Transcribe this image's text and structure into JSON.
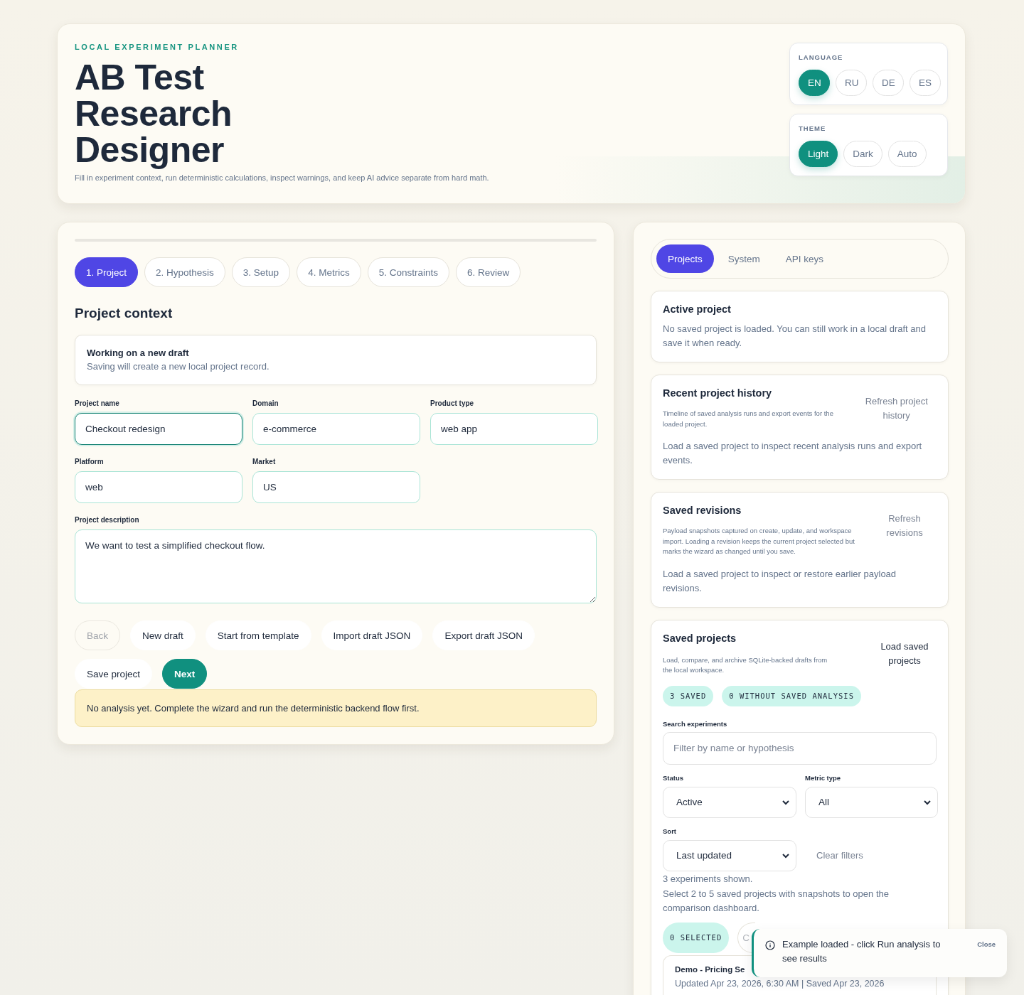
{
  "header": {
    "eyebrow": "LOCAL EXPERIMENT PLANNER",
    "title": "AB Test Research Designer",
    "subtitle": "Fill in experiment context, run deterministic calculations, inspect warnings, and keep AI advice separate from hard math."
  },
  "language": {
    "label": "LANGUAGE",
    "options": [
      {
        "label": "EN",
        "selected": true
      },
      {
        "label": "RU",
        "selected": false
      },
      {
        "label": "DE",
        "selected": false
      },
      {
        "label": "ES",
        "selected": false
      }
    ]
  },
  "theme": {
    "label": "THEME",
    "options": [
      {
        "label": "Light",
        "selected": true
      },
      {
        "label": "Dark",
        "selected": false
      },
      {
        "label": "Auto",
        "selected": false
      }
    ]
  },
  "wizard": {
    "steps": [
      {
        "label": "1. Project",
        "selected": true
      },
      {
        "label": "2. Hypothesis",
        "selected": false
      },
      {
        "label": "3. Setup",
        "selected": false
      },
      {
        "label": "4. Metrics",
        "selected": false
      },
      {
        "label": "5. Constraints",
        "selected": false
      },
      {
        "label": "6. Review",
        "selected": false
      }
    ],
    "section_title": "Project context",
    "draft_notice": {
      "title": "Working on a new draft",
      "text": "Saving will create a new local project record."
    },
    "fields": [
      {
        "label": "Project name",
        "value": "Checkout redesign",
        "focused": true
      },
      {
        "label": "Domain",
        "value": "e-commerce",
        "focused": false
      },
      {
        "label": "Product type",
        "value": "web app",
        "focused": false
      },
      {
        "label": "Platform",
        "value": "web",
        "focused": false
      },
      {
        "label": "Market",
        "value": "US",
        "focused": false
      }
    ],
    "description": {
      "label": "Project description",
      "value": "We want to test a simplified checkout flow."
    },
    "actions": [
      {
        "label": "Back",
        "primary": false,
        "disabled": true
      },
      {
        "label": "New draft",
        "primary": false,
        "disabled": false
      },
      {
        "label": "Start from template",
        "primary": false,
        "disabled": false
      },
      {
        "label": "Import draft JSON",
        "primary": false,
        "disabled": false
      },
      {
        "label": "Export draft JSON",
        "primary": false,
        "disabled": false
      },
      {
        "label": "Save project",
        "primary": false,
        "disabled": false
      },
      {
        "label": "Next",
        "primary": true,
        "disabled": false
      }
    ],
    "notice": "No analysis yet. Complete the wizard and run the deterministic backend flow first."
  },
  "sidebar": {
    "tabs": [
      {
        "label": "Projects",
        "selected": true
      },
      {
        "label": "System",
        "selected": false
      },
      {
        "label": "API keys",
        "selected": false
      }
    ],
    "active_project": {
      "title": "Active project",
      "text": "No saved project is loaded. You can still work in a local draft and save it when ready."
    },
    "history": {
      "title": "Recent project history",
      "description": "Timeline of saved analysis runs and export events for the loaded project.",
      "action": "Refresh project history",
      "empty": "Load a saved project to inspect recent analysis runs and export events."
    },
    "revisions": {
      "title": "Saved revisions",
      "description": "Payload snapshots captured on create, update, and workspace import. Loading a revision keeps the current project selected but marks the wizard as changed until you save.",
      "action": "Refresh revisions",
      "empty": "Load a saved project to inspect or restore earlier payload revisions."
    },
    "saved_projects": {
      "title": "Saved projects",
      "description": "Load, compare, and archive SQLite-backed drafts from the local workspace.",
      "action": "Load saved projects",
      "badges": [
        "3 SAVED",
        "0 WITHOUT SAVED ANALYSIS"
      ],
      "search": {
        "label": "Search experiments",
        "placeholder": "Filter by name or hypothesis"
      },
      "filters": [
        {
          "label": "Status",
          "value": "Active"
        },
        {
          "label": "Metric type",
          "value": "All"
        }
      ],
      "sort": {
        "label": "Sort",
        "value": "Last updated"
      },
      "clear": "Clear filters",
      "count": "3 experiments shown.",
      "hint": "Select 2 to 5 saved projects with snapshots to open the comparison dashboard.",
      "selection": "0 SELECTED",
      "compare": {
        "label": "C",
        "disabled": true
      },
      "projects": [
        {
          "name": "Demo - Pricing Se",
          "meta": "Updated Apr 23, 2026, 6:30 AM | Saved Apr 23, 2026"
        }
      ]
    }
  },
  "toast": {
    "message": "Example loaded - click Run analysis to see results",
    "close": "Close"
  }
}
